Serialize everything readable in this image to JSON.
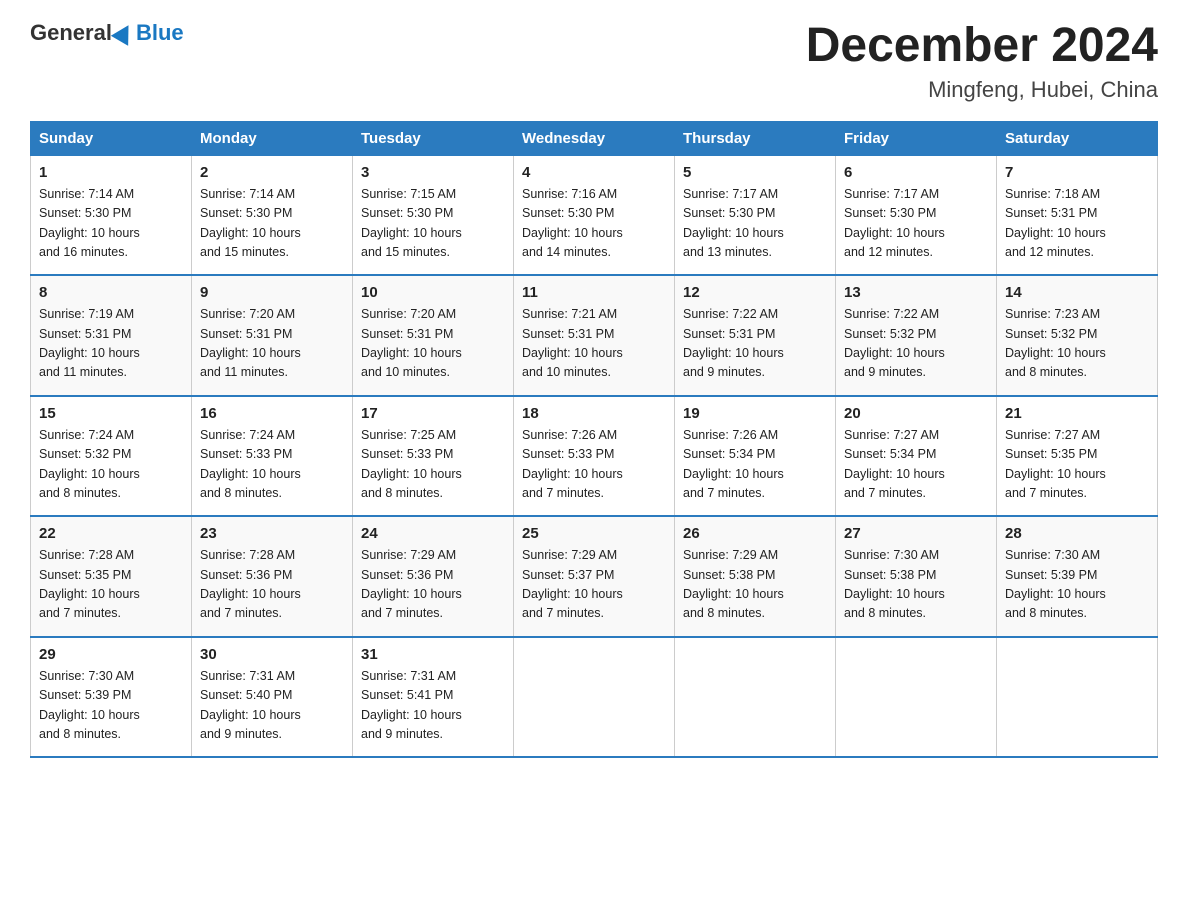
{
  "header": {
    "logo_general": "General",
    "logo_blue": "Blue",
    "month_title": "December 2024",
    "location": "Mingfeng, Hubei, China"
  },
  "weekdays": [
    "Sunday",
    "Monday",
    "Tuesday",
    "Wednesday",
    "Thursday",
    "Friday",
    "Saturday"
  ],
  "weeks": [
    [
      {
        "day": "1",
        "sunrise": "7:14 AM",
        "sunset": "5:30 PM",
        "daylight": "10 hours and 16 minutes."
      },
      {
        "day": "2",
        "sunrise": "7:14 AM",
        "sunset": "5:30 PM",
        "daylight": "10 hours and 15 minutes."
      },
      {
        "day": "3",
        "sunrise": "7:15 AM",
        "sunset": "5:30 PM",
        "daylight": "10 hours and 15 minutes."
      },
      {
        "day": "4",
        "sunrise": "7:16 AM",
        "sunset": "5:30 PM",
        "daylight": "10 hours and 14 minutes."
      },
      {
        "day": "5",
        "sunrise": "7:17 AM",
        "sunset": "5:30 PM",
        "daylight": "10 hours and 13 minutes."
      },
      {
        "day": "6",
        "sunrise": "7:17 AM",
        "sunset": "5:30 PM",
        "daylight": "10 hours and 12 minutes."
      },
      {
        "day": "7",
        "sunrise": "7:18 AM",
        "sunset": "5:31 PM",
        "daylight": "10 hours and 12 minutes."
      }
    ],
    [
      {
        "day": "8",
        "sunrise": "7:19 AM",
        "sunset": "5:31 PM",
        "daylight": "10 hours and 11 minutes."
      },
      {
        "day": "9",
        "sunrise": "7:20 AM",
        "sunset": "5:31 PM",
        "daylight": "10 hours and 11 minutes."
      },
      {
        "day": "10",
        "sunrise": "7:20 AM",
        "sunset": "5:31 PM",
        "daylight": "10 hours and 10 minutes."
      },
      {
        "day": "11",
        "sunrise": "7:21 AM",
        "sunset": "5:31 PM",
        "daylight": "10 hours and 10 minutes."
      },
      {
        "day": "12",
        "sunrise": "7:22 AM",
        "sunset": "5:31 PM",
        "daylight": "10 hours and 9 minutes."
      },
      {
        "day": "13",
        "sunrise": "7:22 AM",
        "sunset": "5:32 PM",
        "daylight": "10 hours and 9 minutes."
      },
      {
        "day": "14",
        "sunrise": "7:23 AM",
        "sunset": "5:32 PM",
        "daylight": "10 hours and 8 minutes."
      }
    ],
    [
      {
        "day": "15",
        "sunrise": "7:24 AM",
        "sunset": "5:32 PM",
        "daylight": "10 hours and 8 minutes."
      },
      {
        "day": "16",
        "sunrise": "7:24 AM",
        "sunset": "5:33 PM",
        "daylight": "10 hours and 8 minutes."
      },
      {
        "day": "17",
        "sunrise": "7:25 AM",
        "sunset": "5:33 PM",
        "daylight": "10 hours and 8 minutes."
      },
      {
        "day": "18",
        "sunrise": "7:26 AM",
        "sunset": "5:33 PM",
        "daylight": "10 hours and 7 minutes."
      },
      {
        "day": "19",
        "sunrise": "7:26 AM",
        "sunset": "5:34 PM",
        "daylight": "10 hours and 7 minutes."
      },
      {
        "day": "20",
        "sunrise": "7:27 AM",
        "sunset": "5:34 PM",
        "daylight": "10 hours and 7 minutes."
      },
      {
        "day": "21",
        "sunrise": "7:27 AM",
        "sunset": "5:35 PM",
        "daylight": "10 hours and 7 minutes."
      }
    ],
    [
      {
        "day": "22",
        "sunrise": "7:28 AM",
        "sunset": "5:35 PM",
        "daylight": "10 hours and 7 minutes."
      },
      {
        "day": "23",
        "sunrise": "7:28 AM",
        "sunset": "5:36 PM",
        "daylight": "10 hours and 7 minutes."
      },
      {
        "day": "24",
        "sunrise": "7:29 AM",
        "sunset": "5:36 PM",
        "daylight": "10 hours and 7 minutes."
      },
      {
        "day": "25",
        "sunrise": "7:29 AM",
        "sunset": "5:37 PM",
        "daylight": "10 hours and 7 minutes."
      },
      {
        "day": "26",
        "sunrise": "7:29 AM",
        "sunset": "5:38 PM",
        "daylight": "10 hours and 8 minutes."
      },
      {
        "day": "27",
        "sunrise": "7:30 AM",
        "sunset": "5:38 PM",
        "daylight": "10 hours and 8 minutes."
      },
      {
        "day": "28",
        "sunrise": "7:30 AM",
        "sunset": "5:39 PM",
        "daylight": "10 hours and 8 minutes."
      }
    ],
    [
      {
        "day": "29",
        "sunrise": "7:30 AM",
        "sunset": "5:39 PM",
        "daylight": "10 hours and 8 minutes."
      },
      {
        "day": "30",
        "sunrise": "7:31 AM",
        "sunset": "5:40 PM",
        "daylight": "10 hours and 9 minutes."
      },
      {
        "day": "31",
        "sunrise": "7:31 AM",
        "sunset": "5:41 PM",
        "daylight": "10 hours and 9 minutes."
      },
      null,
      null,
      null,
      null
    ]
  ],
  "labels": {
    "sunrise": "Sunrise:",
    "sunset": "Sunset:",
    "daylight": "Daylight:"
  }
}
